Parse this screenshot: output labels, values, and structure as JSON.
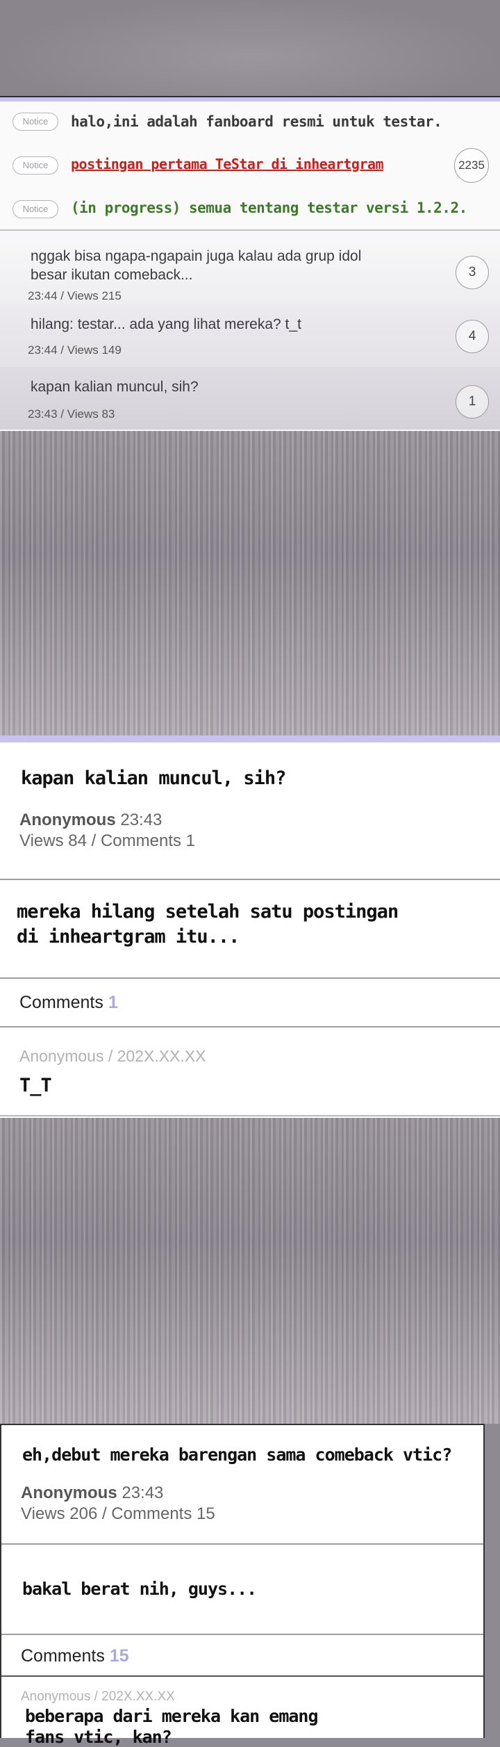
{
  "notices": [
    {
      "badge": "Notice",
      "title": "halo,ini adalah fanboard resmi untuk testar."
    },
    {
      "badge": "Notice",
      "title": "postingan pertama TeStar di inheartgram",
      "count": "2235"
    },
    {
      "badge": "Notice",
      "title": "(in progress) semua tentang testar versi 1.2.2."
    }
  ],
  "posts": [
    {
      "title_line1": "nggak bisa ngapa-ngapain juga kalau ada grup idol",
      "title_line2": "besar ikutan comeback...",
      "meta": "23:44 / Views 215",
      "count": "3"
    },
    {
      "title_line1": "hilang: testar... ada yang lihat mereka? t_t",
      "meta": "23:44 / Views 149",
      "count": "4"
    },
    {
      "title_line1": "kapan kalian muncul, sih?",
      "meta": "23:43 / Views 83",
      "count": "1"
    }
  ],
  "article1": {
    "title": "kapan kalian muncul, sih?",
    "author": "Anonymous",
    "time": "23:43",
    "stats": "Views 84 / Comments 1",
    "body_line1": "mereka hilang setelah satu postingan",
    "body_line2": "di inheartgram itu...",
    "comments_label": "Comments",
    "comments_count": "1",
    "comment_author": "Anonymous / 202X.XX.XX",
    "comment_text": "T_T"
  },
  "article2": {
    "title": "eh,debut mereka barengan sama comeback vtic?",
    "author": "Anonymous",
    "time": "23:43",
    "stats": "Views 206 / Comments 15",
    "body": "bakal berat nih, guys...",
    "comments_label": "Comments",
    "comments_count": "15",
    "comment_author": "Anonymous / 202X.XX.XX",
    "comment_line1": "beberapa dari mereka kan emang",
    "comment_line2": "fans vtic, kan?"
  },
  "colors": {
    "notice1": "#3a3a3a",
    "notice2": "#c8201d",
    "notice3": "#3d7a2a",
    "accent": "#a9a8df"
  }
}
